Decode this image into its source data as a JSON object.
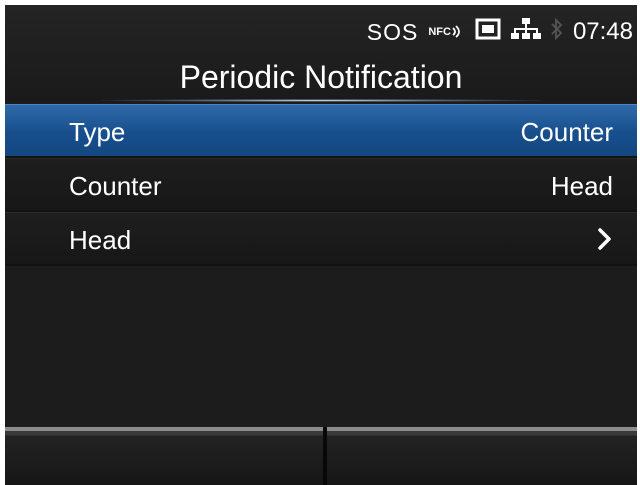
{
  "status_bar": {
    "sos": "SOS",
    "nfc": "NFC",
    "icons": [
      "nfc-icon",
      "card-icon",
      "network-icon",
      "bluetooth-icon"
    ],
    "time": "07:48"
  },
  "header": {
    "title": "Periodic Notification"
  },
  "menu": {
    "items": [
      {
        "label": "Type",
        "value": "Counter",
        "selected": true
      },
      {
        "label": "Counter",
        "value": "Head",
        "selected": false
      },
      {
        "label": "Head",
        "value": "",
        "has_submenu": true,
        "selected": false
      }
    ]
  },
  "footer": {
    "left_softkey": "",
    "right_softkey": ""
  },
  "colors": {
    "selected": "#1a528f",
    "background": "#1c1c1c",
    "softkey_edge": "#8c8c8c"
  }
}
